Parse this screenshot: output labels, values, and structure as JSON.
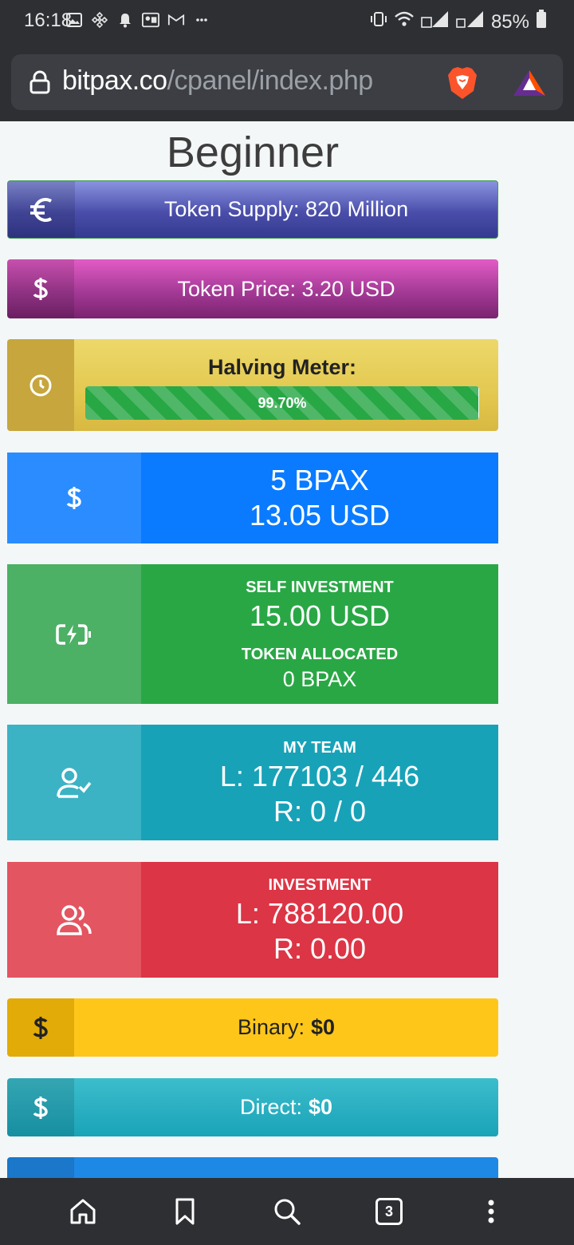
{
  "status_bar": {
    "time": "16:18",
    "battery": "85%",
    "icons": [
      "gallery-icon",
      "binance-icon",
      "bell-icon",
      "sim-icon",
      "gmail-icon",
      "more-icon",
      "vibrate-icon",
      "wifi-icon",
      "signal-1-icon",
      "signal-2-icon",
      "battery-icon"
    ]
  },
  "browser": {
    "url_domain": "bitpax.co",
    "url_path": "/cpanel/index.php",
    "tab_count": "3"
  },
  "page": {
    "title": "Beginner"
  },
  "token_supply": {
    "label": "Token Supply: 820 Million",
    "icon": "euro-icon"
  },
  "token_price": {
    "label": "Token Price: 3.20 USD",
    "icon": "dollar-icon"
  },
  "halving": {
    "title": "Halving Meter:",
    "progress_label": "99.70%",
    "progress_fraction": 0.997,
    "icon": "clock-icon"
  },
  "balance": {
    "bpax": "5 BPAX",
    "usd": "13.05 USD"
  },
  "self_investment": {
    "heading": "SELF INVESTMENT",
    "value": "15.00 USD",
    "token_heading": "TOKEN ALLOCATED",
    "token_value": "0 BPAX"
  },
  "team": {
    "heading": "MY TEAM",
    "left": "L: 177103 / 446",
    "right": "R: 0 / 0"
  },
  "investment": {
    "heading": "INVESTMENT",
    "left": "L: 788120.00",
    "right": "R: 0.00"
  },
  "binary": {
    "label": "Binary:",
    "value": "$0"
  },
  "direct": {
    "label": "Direct:",
    "value": "$0"
  },
  "colors": {
    "supply": "#4a4eaa",
    "price": "#a43a96",
    "halving": "#e3c850",
    "bpax": "#0a7bff",
    "self": "#2aa745",
    "team": "#18a2b8",
    "investment": "#dc3545",
    "binary": "#ffc61a",
    "direct": "#1aa3b8"
  }
}
